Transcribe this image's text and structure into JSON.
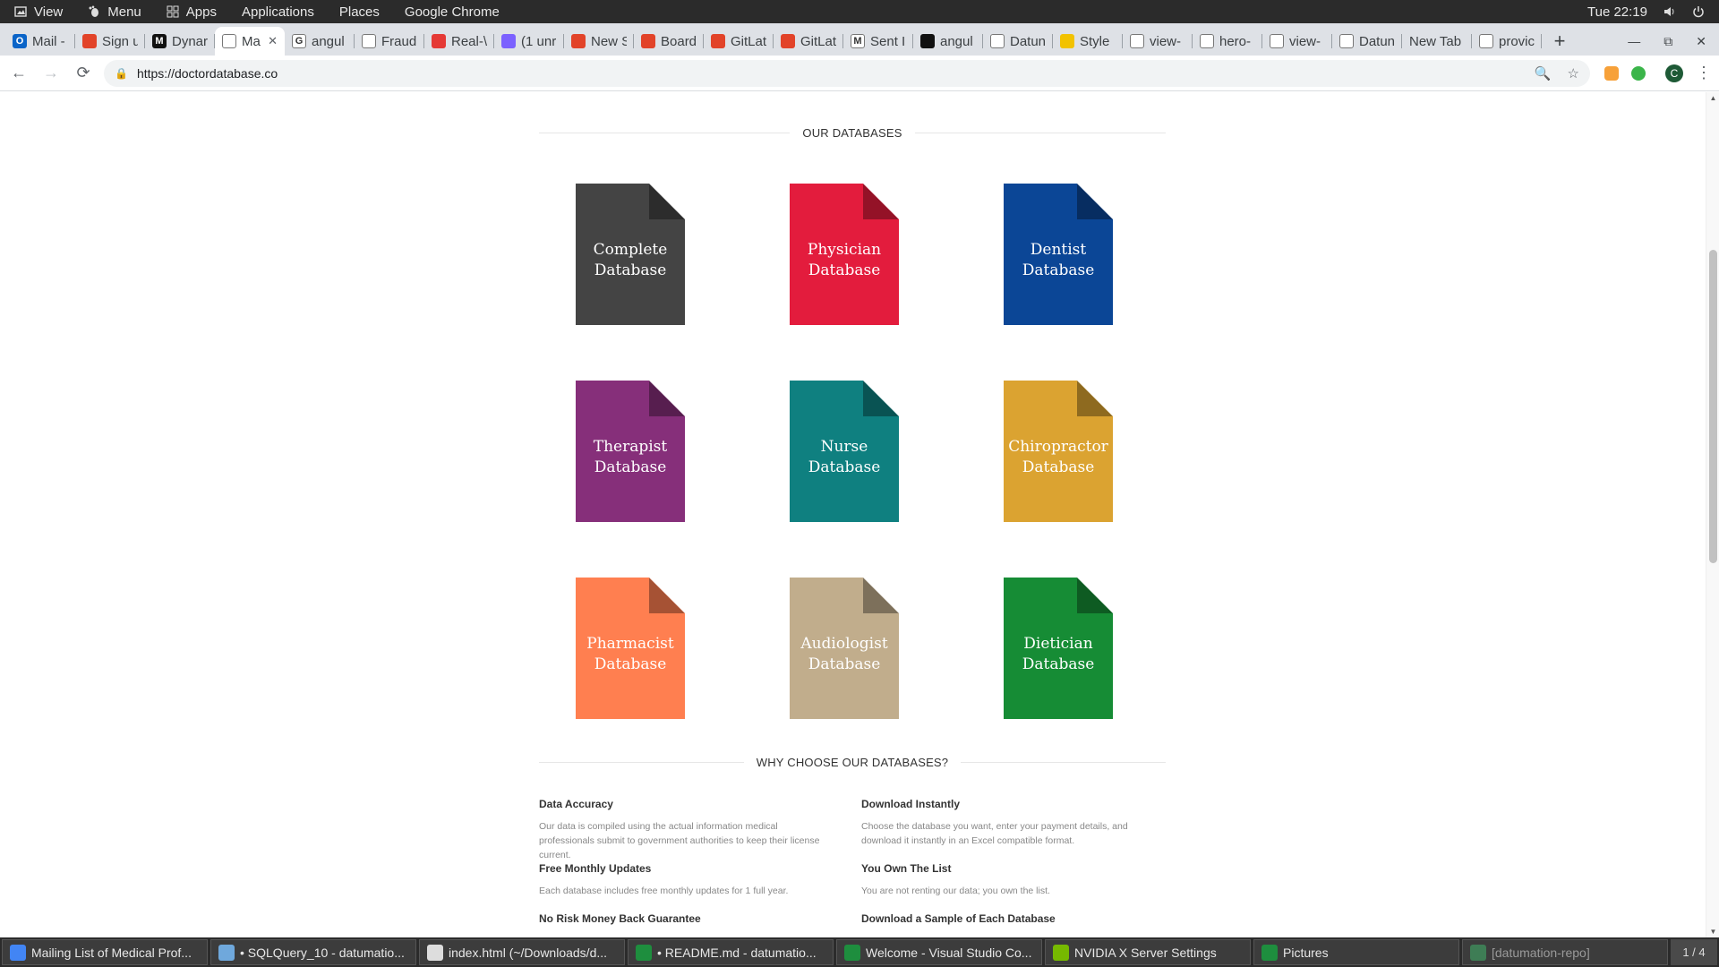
{
  "panel": {
    "view": "View",
    "menu": "Menu",
    "apps": "Apps",
    "applications": "Applications",
    "places": "Places",
    "active_app": "Google Chrome",
    "clock": "Tue 22:19"
  },
  "tabs": [
    {
      "label": "Mail -",
      "fav_color": "#0a64c8",
      "fav": "O"
    },
    {
      "label": "Sign u",
      "fav_color": "#e24329",
      "fav": ""
    },
    {
      "label": "Dynar",
      "fav_color": "#111111",
      "fav": "M"
    },
    {
      "label": "Ma",
      "fav_color": "#ffffff",
      "fav": "",
      "active": true
    },
    {
      "label": "angul",
      "fav_color": "#ffffff",
      "fav": "G"
    },
    {
      "label": "Fraud",
      "fav_color": "#ffffff",
      "fav": ""
    },
    {
      "label": "Real-\\",
      "fav_color": "#e53935",
      "fav": ""
    },
    {
      "label": "(1 unr",
      "fav_color": "#7b61ff",
      "fav": ""
    },
    {
      "label": "New S",
      "fav_color": "#e24329",
      "fav": ""
    },
    {
      "label": "Board",
      "fav_color": "#e24329",
      "fav": ""
    },
    {
      "label": "GitLat",
      "fav_color": "#e24329",
      "fav": ""
    },
    {
      "label": "GitLat",
      "fav_color": "#e24329",
      "fav": ""
    },
    {
      "label": "Sent I",
      "fav_color": "#ffffff",
      "fav": "M"
    },
    {
      "label": "angul",
      "fav_color": "#111111",
      "fav": ""
    },
    {
      "label": "Datun",
      "fav_color": "#ffffff",
      "fav": ""
    },
    {
      "label": "Style",
      "fav_color": "#f2c200",
      "fav": ""
    },
    {
      "label": "view-",
      "fav_color": "#ffffff",
      "fav": ""
    },
    {
      "label": "hero-",
      "fav_color": "#ffffff",
      "fav": ""
    },
    {
      "label": "view-",
      "fav_color": "#ffffff",
      "fav": ""
    },
    {
      "label": "Datun",
      "fav_color": "#ffffff",
      "fav": ""
    },
    {
      "label": "New Tab",
      "fav_color": "",
      "fav": ""
    },
    {
      "label": "provic",
      "fav_color": "#ffffff",
      "fav": ""
    }
  ],
  "address": {
    "url": "https://doctordatabase.co"
  },
  "profile_initial": "C",
  "page": {
    "databases_heading": "OUR DATABASES",
    "databases": [
      {
        "line1": "Complete",
        "line2": "Database",
        "color": "#444444"
      },
      {
        "line1": "Physician",
        "line2": "Database",
        "color": "#e31c3d"
      },
      {
        "line1": "Dentist",
        "line2": "Database",
        "color": "#0b4696"
      },
      {
        "line1": "Therapist",
        "line2": "Database",
        "color": "#862f7a"
      },
      {
        "line1": "Nurse",
        "line2": "Database",
        "color": "#0f8080"
      },
      {
        "line1": "Chiropractor",
        "line2": "Database",
        "color": "#dba331"
      },
      {
        "line1": "Pharmacist",
        "line2": "Database",
        "color": "#ff7f50"
      },
      {
        "line1": "Audiologist",
        "line2": "Database",
        "color": "#c1ad8c"
      },
      {
        "line1": "Dietician",
        "line2": "Database",
        "color": "#168c35"
      }
    ],
    "why_heading": "WHY CHOOSE OUR DATABASES?",
    "why": [
      {
        "title": "Data Accuracy",
        "body": "Our data is compiled using the actual information medical professionals submit to government authorities to keep their license current."
      },
      {
        "title": "Download Instantly",
        "body": "Choose the database you want, enter your payment details, and download it instantly in an Excel compatible format."
      },
      {
        "title": "Free Monthly Updates",
        "body": "Each database includes free monthly updates for 1 full year."
      },
      {
        "title": "You Own The List",
        "body": "You are not renting our data; you own the list."
      },
      {
        "title": "No Risk Money Back Guarantee",
        "body": ""
      },
      {
        "title": "Download a Sample of Each Database",
        "body": ""
      }
    ]
  },
  "taskbar": {
    "items": [
      {
        "label": "Mailing List of Medical Prof...",
        "icon_color": "#4285f4"
      },
      {
        "label": "• SQLQuery_10 - datumatio...",
        "icon_color": "#6fa8dc"
      },
      {
        "label": "index.html (~/Downloads/d...",
        "icon_color": "#dddddd"
      },
      {
        "label": "• README.md - datumatio...",
        "icon_color": "#1e8e3e"
      },
      {
        "label": "Welcome - Visual Studio Co...",
        "icon_color": "#1e8e3e"
      },
      {
        "label": "NVIDIA X Server Settings",
        "icon_color": "#76b900"
      },
      {
        "label": "Pictures",
        "icon_color": "#1e8e3e"
      },
      {
        "label": "[datumation-repo]",
        "icon_color": "#3e7d55"
      }
    ],
    "pager": "1 / 4"
  }
}
